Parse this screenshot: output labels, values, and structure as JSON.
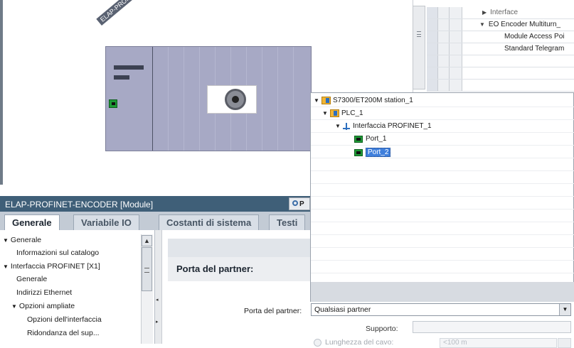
{
  "device_view": {
    "device_label": "ELAP-PROFI"
  },
  "device_overview": {
    "rows": [
      {
        "text": "Interface",
        "expander": "▶",
        "indent": 78,
        "dim": true
      },
      {
        "text": "EO Encoder Multiturn_",
        "expander": "▼",
        "indent": 74,
        "dim": false
      },
      {
        "text": "Module Access Poi",
        "expander": "",
        "indent": 109,
        "dim": false
      },
      {
        "text": "Standard Telegram",
        "expander": "",
        "indent": 109,
        "dim": false
      }
    ]
  },
  "project_tree": {
    "station": "S7300/ET200M station_1",
    "plc": "PLC_1",
    "interface": "Interfaccia PROFINET_1",
    "port1": "Port_1",
    "port2": "Port_2"
  },
  "properties": {
    "title": "ELAP-PROFINET-ENCODER [Module]",
    "header_button": "P",
    "tabs": [
      "Generale",
      "Variabile IO",
      "Costanti di sistema",
      "Testi"
    ],
    "nav": [
      {
        "label": "Generale",
        "expander": "▼",
        "level": 0
      },
      {
        "label": "Informazioni sul catalogo",
        "expander": "",
        "level": 2
      },
      {
        "label": "Interfaccia PROFINET [X1]",
        "expander": "▼",
        "level": 0
      },
      {
        "label": "Generale",
        "expander": "",
        "level": 1
      },
      {
        "label": "Indirizzi Ethernet",
        "expander": "",
        "level": 1
      },
      {
        "label": "Opzioni ampliate",
        "expander": "▼",
        "level": 1
      },
      {
        "label": "Opzioni dell'interfaccia",
        "expander": "",
        "level": 3
      },
      {
        "label": "Ridondanza del sup...",
        "expander": "",
        "level": 3
      }
    ],
    "section_title": "Porta del partner:",
    "partner_label": "Porta del partner:",
    "partner_value": "Qualsiasi partner",
    "support_label": "Supporto:",
    "cable_label": "Lunghezza del cavo:",
    "cable_value": "<100 m"
  }
}
